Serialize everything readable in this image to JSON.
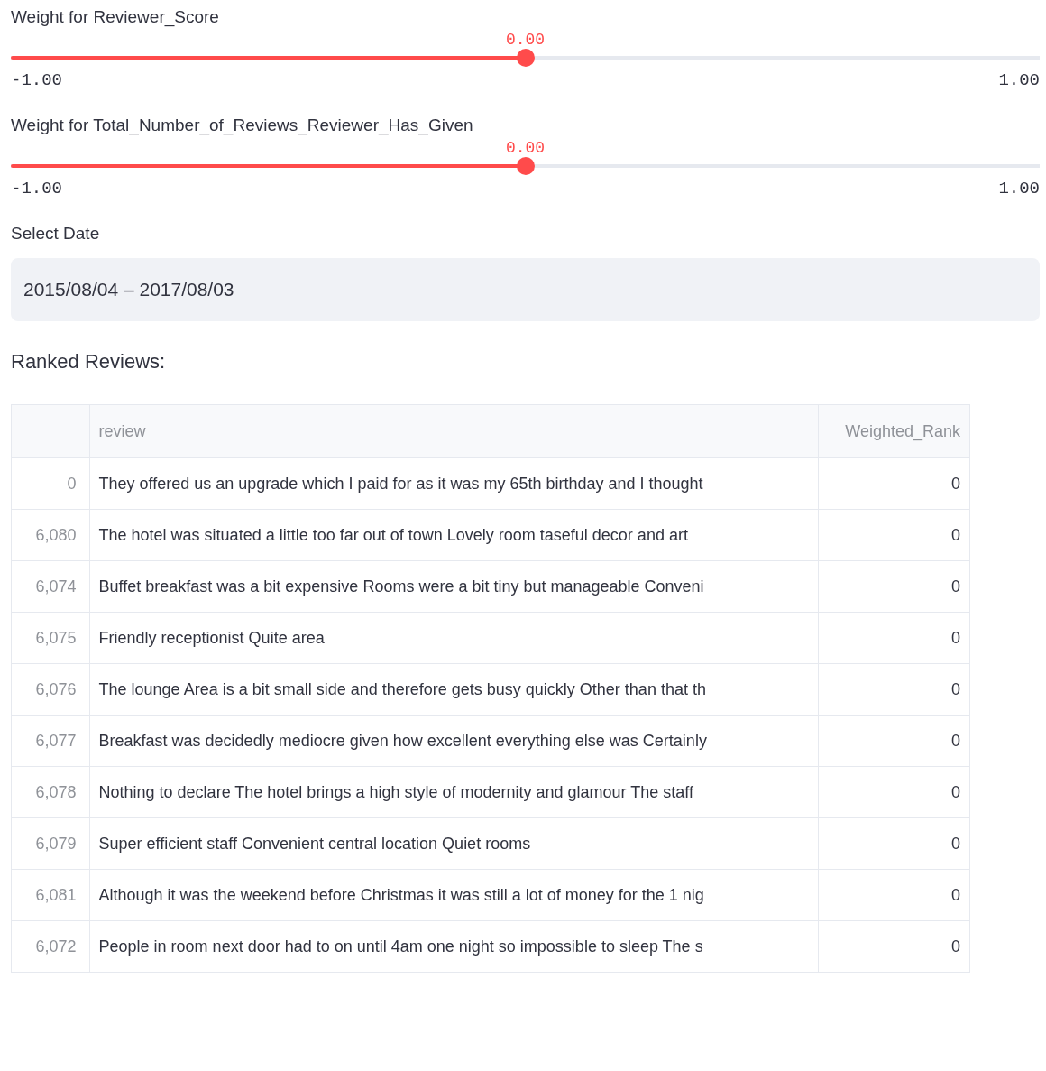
{
  "sliders": [
    {
      "label": "Weight for Reviewer_Score",
      "value": "0.00",
      "level": 0.5,
      "min": "-1.00",
      "max": "1.00"
    },
    {
      "label": "Weight for Total_Number_of_Reviews_Reviewer_Has_Given",
      "value": "0.00",
      "level": 0.5,
      "min": "-1.00",
      "max": "1.00"
    }
  ],
  "date_input": {
    "label": "Select Date",
    "value": "2015/08/04 – 2017/08/03"
  },
  "table_heading": "Ranked Reviews:",
  "table": {
    "columns": [
      "review",
      "Weighted_Rank"
    ],
    "rows": [
      {
        "index": "0",
        "review": "They offered us an upgrade which I paid for as it was my 65th birthday and I thought",
        "rank": "0"
      },
      {
        "index": "6,080",
        "review": "The hotel was situated a little too far out of town  Lovely room taseful decor and art",
        "rank": "0"
      },
      {
        "index": "6,074",
        "review": "Buffet breakfast was a bit expensive Rooms were a bit tiny but manageable Conveni",
        "rank": "0"
      },
      {
        "index": "6,075",
        "review": "Friendly receptionist Quite area",
        "rank": "0"
      },
      {
        "index": "6,076",
        "review": "The lounge Area is a bit small side and therefore gets busy quickly Other than that th",
        "rank": "0"
      },
      {
        "index": "6,077",
        "review": "Breakfast was decidedly mediocre given how excellent everything else was Certainly",
        "rank": "0"
      },
      {
        "index": "6,078",
        "review": "Nothing to declare  The hotel brings a high style of modernity and glamour The staff",
        "rank": "0"
      },
      {
        "index": "6,079",
        "review": "Super efficient staff Convenient central location Quiet rooms",
        "rank": "0"
      },
      {
        "index": "6,081",
        "review": "Although it was the weekend before Christmas it was still a lot of money for the 1 nig",
        "rank": "0"
      },
      {
        "index": "6,072",
        "review": "People in room next door had to on until 4am one night so impossible to sleep The s",
        "rank": "0"
      }
    ]
  }
}
